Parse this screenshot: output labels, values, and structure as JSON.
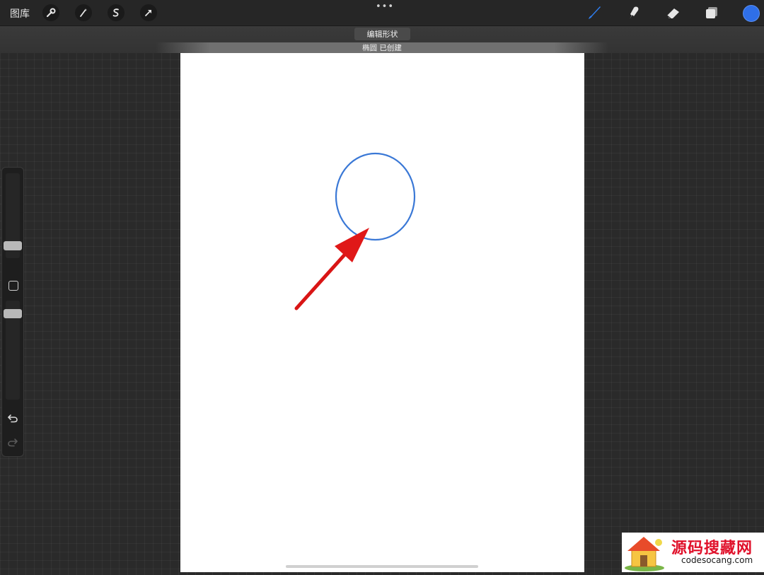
{
  "toolbar": {
    "gallery_label": "图库",
    "left_tools": [
      "wrench-icon",
      "magic-wand-icon",
      "selection-s-icon",
      "transform-arrow-icon"
    ],
    "more_label": "•••",
    "right_tools": [
      "brush-icon",
      "smudge-icon",
      "eraser-icon",
      "layers-icon"
    ],
    "current_color": "#2f6fe8"
  },
  "quickshape": {
    "edit_shape_label": "编辑形状",
    "status_text": "椭圆 已创建"
  },
  "canvas": {
    "background": "#ffffff",
    "shape_stroke": "#3a78d6",
    "arrow_color": "#e01818"
  },
  "sidebar": {
    "brush_size": 0.22,
    "opacity": 0.6
  },
  "watermark": {
    "title": "源码搜藏网",
    "url": "codesocang.com"
  }
}
